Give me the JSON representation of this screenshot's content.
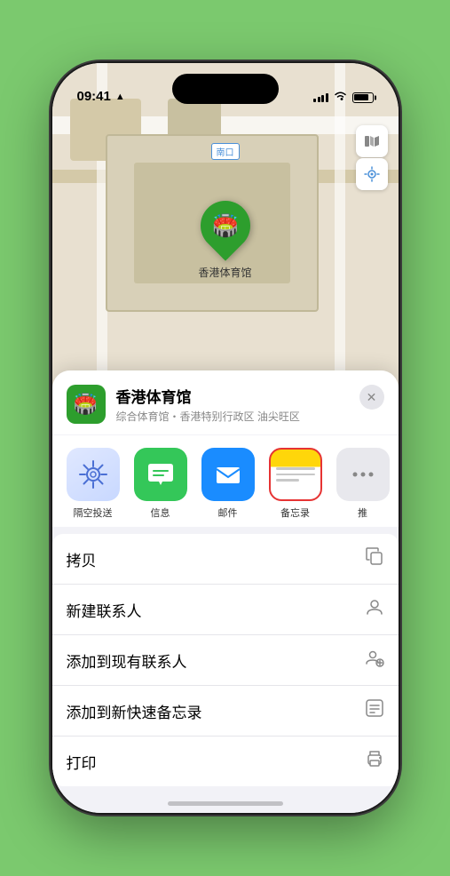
{
  "status_bar": {
    "time": "09:41",
    "location_arrow": "▲"
  },
  "map": {
    "label": "南口",
    "pin_label": "香港体育馆"
  },
  "venue": {
    "name": "香港体育馆",
    "description": "综合体育馆・香港特别行政区 油尖旺区",
    "icon": "🏟️"
  },
  "share_items": [
    {
      "id": "airdrop",
      "label": "隔空投送",
      "icon": "📡"
    },
    {
      "id": "messages",
      "label": "信息",
      "icon": "💬"
    },
    {
      "id": "mail",
      "label": "邮件",
      "icon": "✉️"
    },
    {
      "id": "notes",
      "label": "备忘录",
      "icon": "notes"
    },
    {
      "id": "more",
      "label": "推",
      "icon": "⋯"
    }
  ],
  "actions": [
    {
      "label": "拷贝",
      "icon": "⧉"
    },
    {
      "label": "新建联系人",
      "icon": "👤"
    },
    {
      "label": "添加到现有联系人",
      "icon": "👤+"
    },
    {
      "label": "添加到新快速备忘录",
      "icon": "🗒"
    },
    {
      "label": "打印",
      "icon": "🖨"
    }
  ],
  "close_icon": "✕"
}
